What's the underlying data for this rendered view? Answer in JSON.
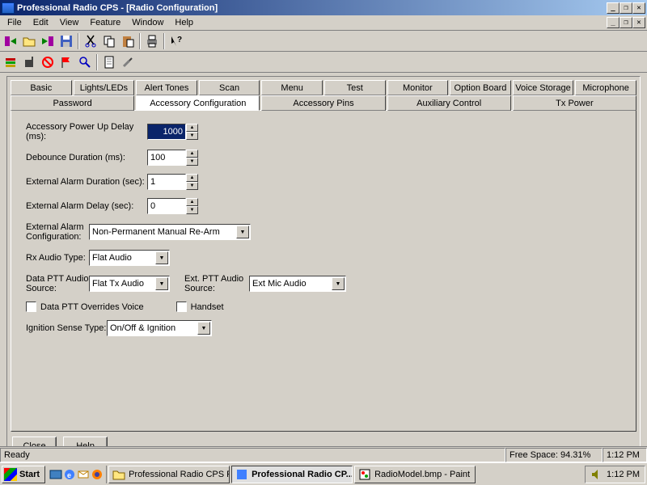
{
  "window": {
    "title": "Professional Radio CPS - [Radio Configuration]"
  },
  "menu": {
    "file": "File",
    "edit": "Edit",
    "view": "View",
    "feature": "Feature",
    "window": "Window",
    "help": "Help"
  },
  "tabs_row1": [
    {
      "label": "Basic"
    },
    {
      "label": "Lights/LEDs"
    },
    {
      "label": "Alert Tones"
    },
    {
      "label": "Scan"
    },
    {
      "label": "Menu"
    },
    {
      "label": "Test"
    },
    {
      "label": "Monitor"
    },
    {
      "label": "Option Board"
    },
    {
      "label": "Voice Storage"
    },
    {
      "label": "Microphone"
    }
  ],
  "tabs_row2": [
    {
      "label": "Password"
    },
    {
      "label": "Accessory Configuration",
      "active": true
    },
    {
      "label": "Accessory Pins"
    },
    {
      "label": "Auxiliary Control"
    },
    {
      "label": "Tx Power"
    }
  ],
  "form": {
    "acc_power_up_delay_label": "Accessory Power Up Delay (ms):",
    "acc_power_up_delay_value": "1000",
    "debounce_label": "Debounce Duration (ms):",
    "debounce_value": "100",
    "ext_alarm_duration_label": "External Alarm Duration (sec):",
    "ext_alarm_duration_value": "1",
    "ext_alarm_delay_label": "External Alarm Delay (sec):",
    "ext_alarm_delay_value": "0",
    "ext_alarm_config_label": "External Alarm Configuration:",
    "ext_alarm_config_value": "Non-Permanent Manual Re-Arm",
    "rx_audio_type_label": "Rx Audio Type:",
    "rx_audio_type_value": "Flat Audio",
    "data_ptt_source_label": "Data PTT Audio Source:",
    "data_ptt_source_value": "Flat Tx Audio",
    "ext_ptt_source_label": "Ext. PTT Audio Source:",
    "ext_ptt_source_value": "Ext Mic Audio",
    "data_ptt_overrides_label": "Data PTT Overrides Voice",
    "handset_label": "Handset",
    "ignition_sense_label": "Ignition Sense Type:",
    "ignition_sense_value": "On/Off & Ignition"
  },
  "buttons": {
    "close": "Close",
    "help": "Help"
  },
  "status": {
    "ready": "Ready",
    "freespace": "Free Space:  94.31%",
    "time": "1:12 PM"
  },
  "taskbar": {
    "start": "Start",
    "task1": "Professional Radio CPS R...",
    "task2": "Professional Radio CP...",
    "task3": "RadioModel.bmp - Paint",
    "tray_time": "1:12 PM"
  }
}
